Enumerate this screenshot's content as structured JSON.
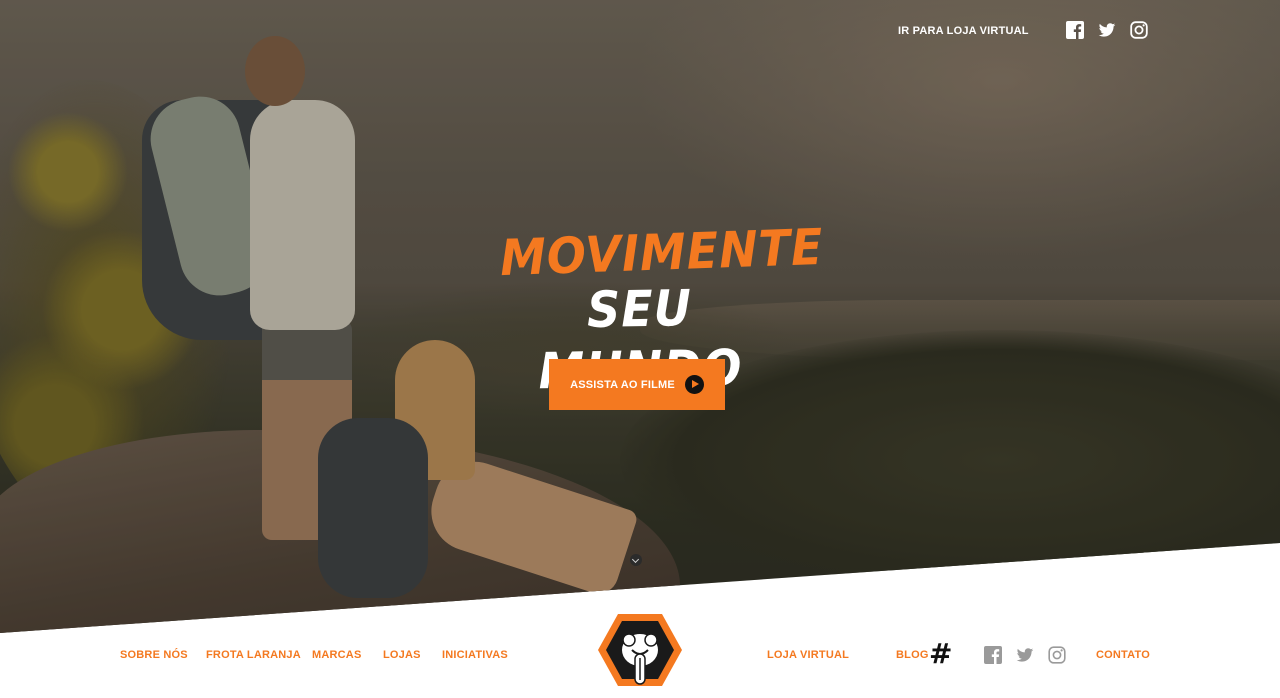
{
  "header": {
    "store_link": "IR PARA LOJA VIRTUAL",
    "social": [
      "facebook-icon",
      "twitter-icon",
      "instagram-icon"
    ]
  },
  "hero": {
    "headline_line1": "MOVIMENTE",
    "headline_line2": "SEU MUNDO",
    "cta_label": "ASSISTA AO FILME"
  },
  "footer_nav": {
    "sobre": "SOBRE NÓS",
    "frota": "FROTA LARANJA",
    "marcas": "MARCAS",
    "lojas": "LOJAS",
    "iniciativas": "INICIATIVAS",
    "loja_virtual": "LOJA VIRTUAL",
    "blog": "BLOG",
    "contato": "CONTATO"
  },
  "colors": {
    "accent": "#f47920",
    "white": "#ffffff",
    "dark": "#111111",
    "social_gray": "#9a9a9a"
  }
}
